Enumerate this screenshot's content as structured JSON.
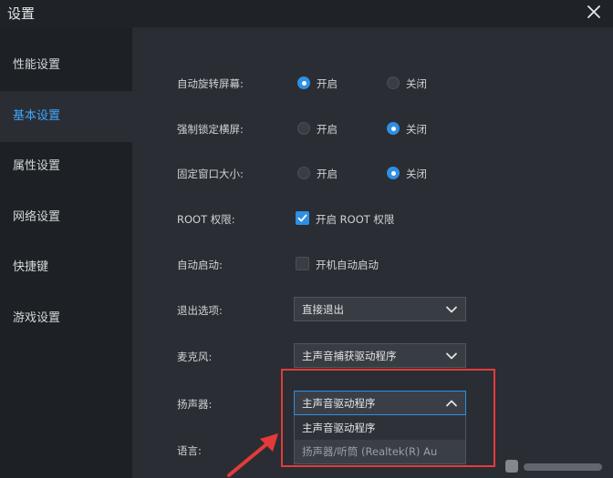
{
  "window": {
    "title": "设置",
    "close_icon": "close-icon"
  },
  "sidebar": {
    "items": [
      {
        "label": "性能设置",
        "active": false
      },
      {
        "label": "基本设置",
        "active": true
      },
      {
        "label": "属性设置",
        "active": false
      },
      {
        "label": "网络设置",
        "active": false
      },
      {
        "label": "快捷键",
        "active": false
      },
      {
        "label": "游戏设置",
        "active": false
      }
    ]
  },
  "settings": {
    "auto_rotate": {
      "label": "自动旋转屏幕:",
      "on_label": "开启",
      "off_label": "关闭",
      "selected": "on"
    },
    "force_landscape": {
      "label": "强制锁定横屏:",
      "on_label": "开启",
      "off_label": "关闭",
      "selected": "off"
    },
    "fixed_window": {
      "label": "固定窗口大小:",
      "on_label": "开启",
      "off_label": "关闭",
      "selected": "off"
    },
    "root": {
      "label": "ROOT 权限:",
      "checkbox_label": "开启 ROOT 权限",
      "checked": true
    },
    "autostart": {
      "label": "自动启动:",
      "checkbox_label": "开机自动启动",
      "checked": false
    },
    "exit_option": {
      "label": "退出选项:",
      "value": "直接退出"
    },
    "microphone": {
      "label": "麦克风:",
      "value": "主声音捕获驱动程序"
    },
    "speaker": {
      "label": "扬声器:",
      "value": "主声音驱动程序",
      "options": [
        "主声音驱动程序",
        "扬声器/听筒 (Realtek(R) Au"
      ]
    },
    "language": {
      "label": "语言:"
    }
  },
  "colors": {
    "accent": "#2f8fe3",
    "highlight": "#e33b3b",
    "active_nav_text": "#3fa8ff"
  }
}
